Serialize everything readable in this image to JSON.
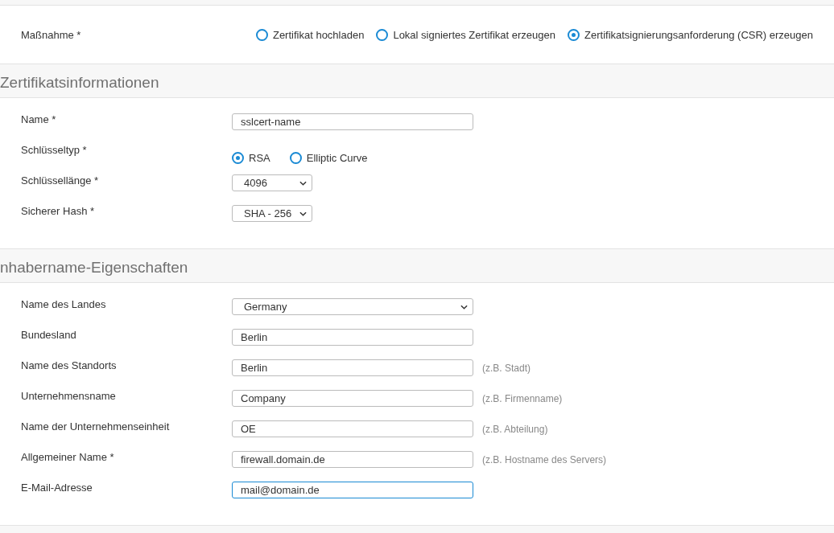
{
  "action": {
    "label": "Maßnahme *",
    "options": [
      {
        "label": "Zertifikat hochladen",
        "selected": false
      },
      {
        "label": "Lokal signiertes Zertifikat erzeugen",
        "selected": false
      },
      {
        "label": "Zertifikatsignierungsanforderung (CSR) erzeugen",
        "selected": true
      }
    ]
  },
  "sections": [
    {
      "title": "Zertifikatsinformationen",
      "rows": [
        {
          "label": "Name *",
          "kind": "text",
          "value": "sslcert-name"
        },
        {
          "label": "Schlüsseltyp *",
          "kind": "radio",
          "options": [
            {
              "label": "RSA",
              "selected": true
            },
            {
              "label": "Elliptic Curve",
              "selected": false
            }
          ]
        },
        {
          "label": "Schlüssellänge *",
          "kind": "select",
          "wide": false,
          "value": "4096"
        },
        {
          "label": "Sicherer Hash *",
          "kind": "select",
          "wide": false,
          "value": "SHA - 256"
        }
      ]
    },
    {
      "title": "nhabername-Eigenschaften",
      "rows": [
        {
          "label": "Name des Landes",
          "kind": "select",
          "wide": true,
          "value": "Germany"
        },
        {
          "label": "Bundesland",
          "kind": "text",
          "value": "Berlin"
        },
        {
          "label": "Name des Standorts",
          "kind": "text",
          "value": "Berlin",
          "hint": "(z.B. Stadt)"
        },
        {
          "label": "Unternehmensname",
          "kind": "text",
          "value": "Company",
          "hint": "(z.B. Firmenname)"
        },
        {
          "label": "Name der Unternehmenseinheit",
          "kind": "text",
          "value": "OE",
          "hint": "(z.B. Abteilung)"
        },
        {
          "label": "Allgemeiner Name *",
          "kind": "text",
          "value": "firewall.domain.de",
          "hint": "(z.B. Hostname des Servers)"
        },
        {
          "label": "E-Mail-Adresse",
          "kind": "text",
          "value": "mail@domain.de",
          "focused": true
        }
      ]
    }
  ]
}
